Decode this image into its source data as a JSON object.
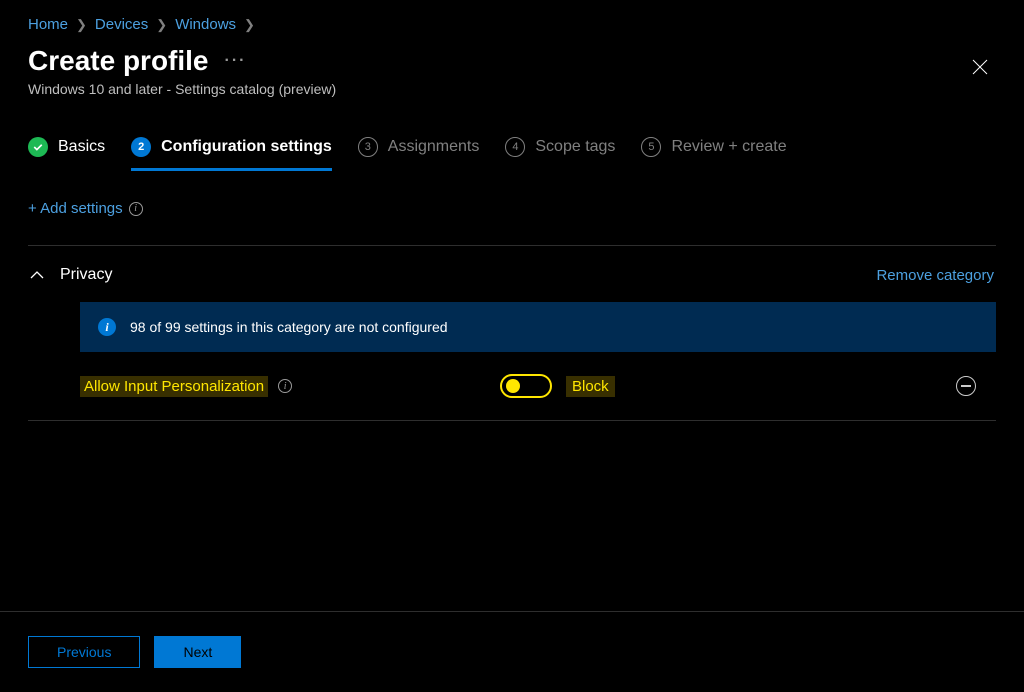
{
  "breadcrumb": {
    "items": [
      "Home",
      "Devices",
      "Windows"
    ]
  },
  "header": {
    "title": "Create profile",
    "subtitle": "Windows 10 and later - Settings catalog (preview)"
  },
  "steps": {
    "basics": "Basics",
    "config": "Configuration settings",
    "assignments": "Assignments",
    "scope": "Scope tags",
    "review": "Review + create",
    "num2": "2",
    "num3": "3",
    "num4": "4",
    "num5": "5"
  },
  "actions": {
    "add_settings": "+ Add settings",
    "remove_category": "Remove category"
  },
  "category": {
    "title": "Privacy",
    "banner": "98 of 99 settings in this category are not configured"
  },
  "settings": {
    "input_personalization": {
      "label": "Allow Input Personalization",
      "value": "Block"
    }
  },
  "footer": {
    "previous": "Previous",
    "next": "Next"
  }
}
